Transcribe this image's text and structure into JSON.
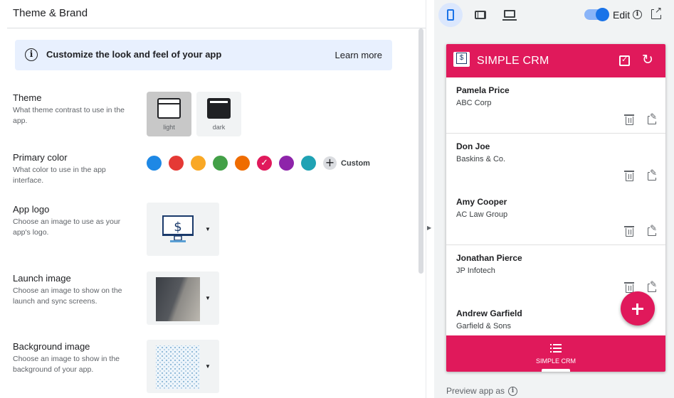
{
  "header": {
    "title": "Theme & Brand"
  },
  "banner": {
    "text": "Customize the look and feel of your app",
    "link": "Learn more",
    "icon": "info-icon"
  },
  "theme": {
    "label": "Theme",
    "description": "What theme contrast to use in the app.",
    "options": [
      {
        "label": "light",
        "selected": true
      },
      {
        "label": "dark",
        "selected": false
      }
    ]
  },
  "primary_color": {
    "label": "Primary color",
    "description": "What color to use in the app interface.",
    "swatches": [
      "#1e88e5",
      "#e53935",
      "#f9a825",
      "#43a047",
      "#ef6c00",
      "#e0195b",
      "#8e24aa",
      "#1fa2b4"
    ],
    "selected": "#e0195b",
    "custom_label": "Custom"
  },
  "app_logo": {
    "label": "App logo",
    "description": "Choose an image to use as your app's logo."
  },
  "launch_image": {
    "label": "Launch image",
    "description": "Choose an image to show on the launch and sync screens."
  },
  "background_image": {
    "label": "Background image",
    "description": "Choose an image to show in the background of your app."
  },
  "preview": {
    "edit_label": "Edit",
    "edit_enabled": true,
    "device_modes": [
      "phone-icon",
      "tablet-icon",
      "laptop-icon"
    ],
    "active_device": "phone-icon",
    "preview_as": "Preview app as",
    "app": {
      "title": "SIMPLE CRM",
      "accent": "#e0195b",
      "contacts": [
        {
          "name": "Pamela Price",
          "company": "ABC Corp"
        },
        {
          "name": "Don Joe",
          "company": "Baskins & Co."
        },
        {
          "name": "Amy Cooper",
          "company": "AC Law Group"
        },
        {
          "name": "Jonathan Pierce",
          "company": "JP Infotech"
        },
        {
          "name": "Andrew Garfield",
          "company": "Garfield & Sons"
        }
      ],
      "bottom_nav_label": "SIMPLE CRM"
    }
  }
}
